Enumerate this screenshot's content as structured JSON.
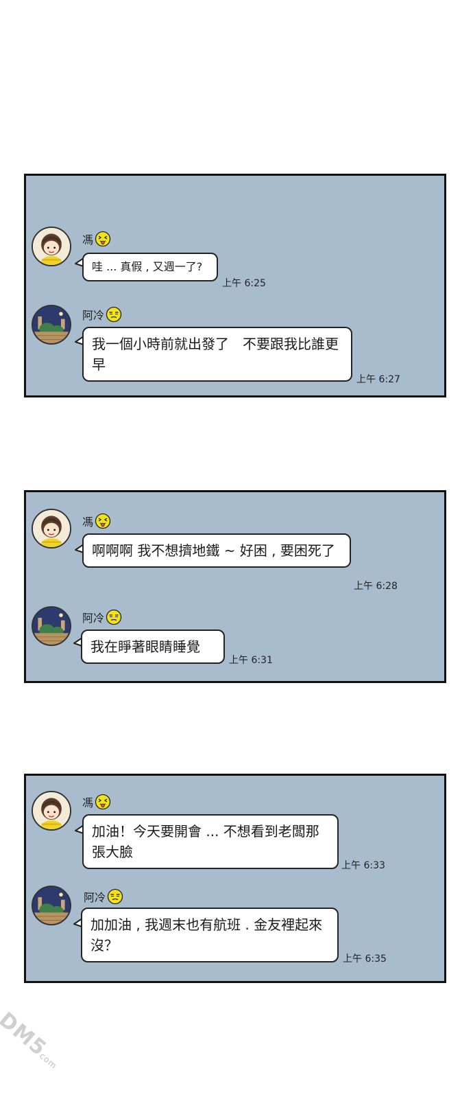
{
  "panels": [
    {
      "messages": [
        {
          "sender": "馮",
          "emoji": "tongue-face-icon",
          "text": "哇 ... 真假 , 又週一了?",
          "time": "上午 6:25"
        },
        {
          "sender": "阿冷",
          "emoji": "sleepy-face-icon",
          "text": "我一個小時前就出發了　不要跟我比誰更早",
          "time": "上午 6:27"
        }
      ]
    },
    {
      "messages": [
        {
          "sender": "馮",
          "emoji": "tongue-face-icon",
          "text": "啊啊啊 我不想擠地鐵 ~ 好困 , 要困死了",
          "time": "上午 6:28"
        },
        {
          "sender": "阿冷",
          "emoji": "sleepy-face-icon",
          "text": "我在睜著眼睛睡覺",
          "time": "上午 6:31"
        }
      ]
    },
    {
      "messages": [
        {
          "sender": "馮",
          "emoji": "tongue-face-icon",
          "text": "加油！今天要開會 ... 不想看到老闆那張大臉",
          "time": "上午 6:33"
        },
        {
          "sender": "阿冷",
          "emoji": "sleepy-face-icon",
          "text": "加加油 , 我週末也有航班 . 金友裡起來沒？",
          "time": "上午 6:35"
        }
      ]
    }
  ],
  "watermark": {
    "main": "DM5",
    "sub": "com"
  },
  "colors": {
    "panel_bg": "#a9bccd",
    "bubble_bg": "#ffffff",
    "emoji_yellow": "#f2e21a"
  }
}
